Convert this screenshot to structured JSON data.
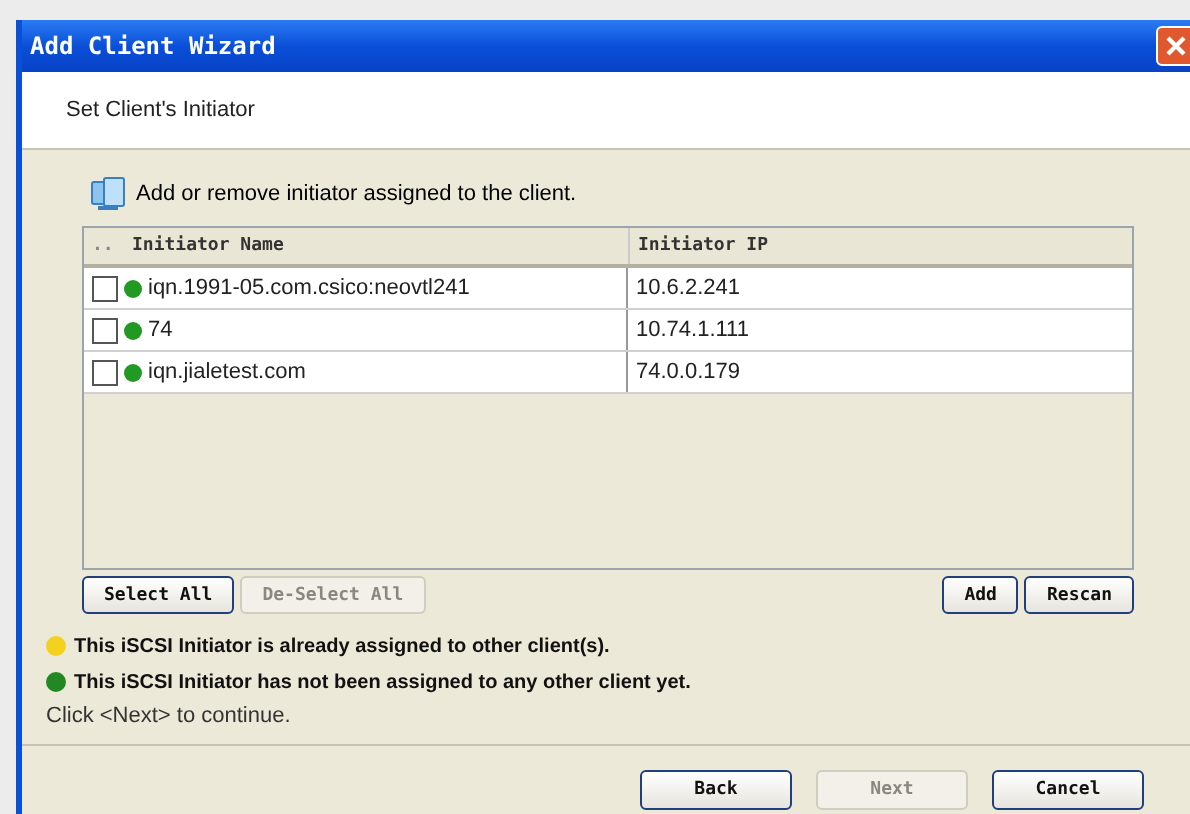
{
  "window": {
    "title": "Add Client Wizard"
  },
  "header": {
    "title": "Set Client's Initiator"
  },
  "instruction": "Add or remove initiator assigned to the client.",
  "table": {
    "columns": [
      "..",
      "Initiator Name",
      "Initiator IP"
    ],
    "rows": [
      {
        "checked": false,
        "color": "#229922",
        "name": "iqn.1991-05.com.csico:neovtl241",
        "ip": "10.6.2.241"
      },
      {
        "checked": false,
        "color": "#229922",
        "name": "74",
        "ip": "10.74.1.111"
      },
      {
        "checked": false,
        "color": "#229922",
        "name": "iqn.jialetest.com",
        "ip": "74.0.0.179"
      }
    ]
  },
  "table_buttons_left": [
    {
      "label": "Select All",
      "disabled": false
    },
    {
      "label": "De-Select All",
      "disabled": true
    }
  ],
  "table_buttons_right": [
    {
      "label": "Add",
      "disabled": false
    },
    {
      "label": "Rescan",
      "disabled": false
    }
  ],
  "legend": [
    {
      "color": "#f2d21e",
      "text": "This iSCSI Initiator is already assigned to other client(s)."
    },
    {
      "color": "#228822",
      "text": "This iSCSI Initiator has not been assigned to any other client yet."
    }
  ],
  "hint": "Click <Next> to continue.",
  "footer_buttons": [
    {
      "label": "Back",
      "disabled": false
    },
    {
      "label": "Next",
      "disabled": true
    },
    {
      "label": "Cancel",
      "disabled": false
    }
  ]
}
